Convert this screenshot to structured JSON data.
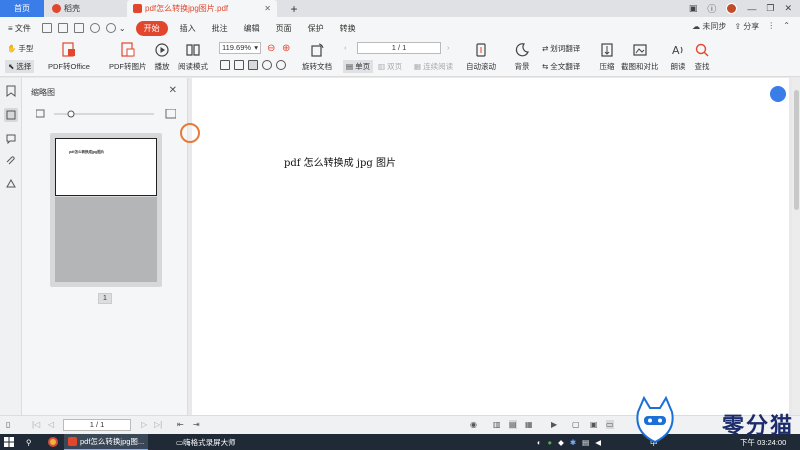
{
  "titlebar": {
    "tabs": [
      {
        "label": "首页"
      },
      {
        "label": "稻壳"
      },
      {
        "label": "pdf怎么转换jpg图片.pdf"
      }
    ],
    "add_tab": "+",
    "close_glyph": "✕"
  },
  "menubar": {
    "file_label": "文件",
    "items": [
      {
        "label": "开始"
      },
      {
        "label": "插入"
      },
      {
        "label": "批注"
      },
      {
        "label": "编辑"
      },
      {
        "label": "页面"
      },
      {
        "label": "保护"
      },
      {
        "label": "转换"
      }
    ],
    "sync_label": "未同步",
    "share_label": "分享"
  },
  "toolbar": {
    "hand_label": "手型",
    "select_label": "选择",
    "pdf_to_office": "PDF转Office",
    "pdf_to_image": "PDF转图片",
    "play": "播放",
    "read_mode": "阅读模式",
    "zoom_value": "119.69%",
    "rotate_doc": "旋转文档",
    "page_value": "1 / 1",
    "single_page": "单页",
    "double_page": "双页",
    "continuous": "连续阅读",
    "auto_scroll": "自动滚动",
    "background": "背景",
    "word_translate": "划词翻译",
    "full_translate": "全文翻译",
    "compress": "压缩",
    "screenshot_compare": "截图和对比",
    "read_aloud": "朗读",
    "search": "查找"
  },
  "thumbnail": {
    "title": "缩略图",
    "page_label": "1",
    "preview_text": "pdf怎么转换成jpg图片"
  },
  "document": {
    "text": "pdf 怎么转换成 jpg 图片"
  },
  "statusbar": {
    "page_value": "1 / 1"
  },
  "taskbar": {
    "app1": "pdf怎么转换jpg图...",
    "app2": "嗨格式录屏大师",
    "ime": "中",
    "clock": "下午 03:24:00"
  },
  "watermark": {
    "text": "零分猫"
  },
  "colors": {
    "accent": "#e2472e",
    "primary_blue": "#3a7ce8",
    "taskbar": "#1f2a36"
  }
}
